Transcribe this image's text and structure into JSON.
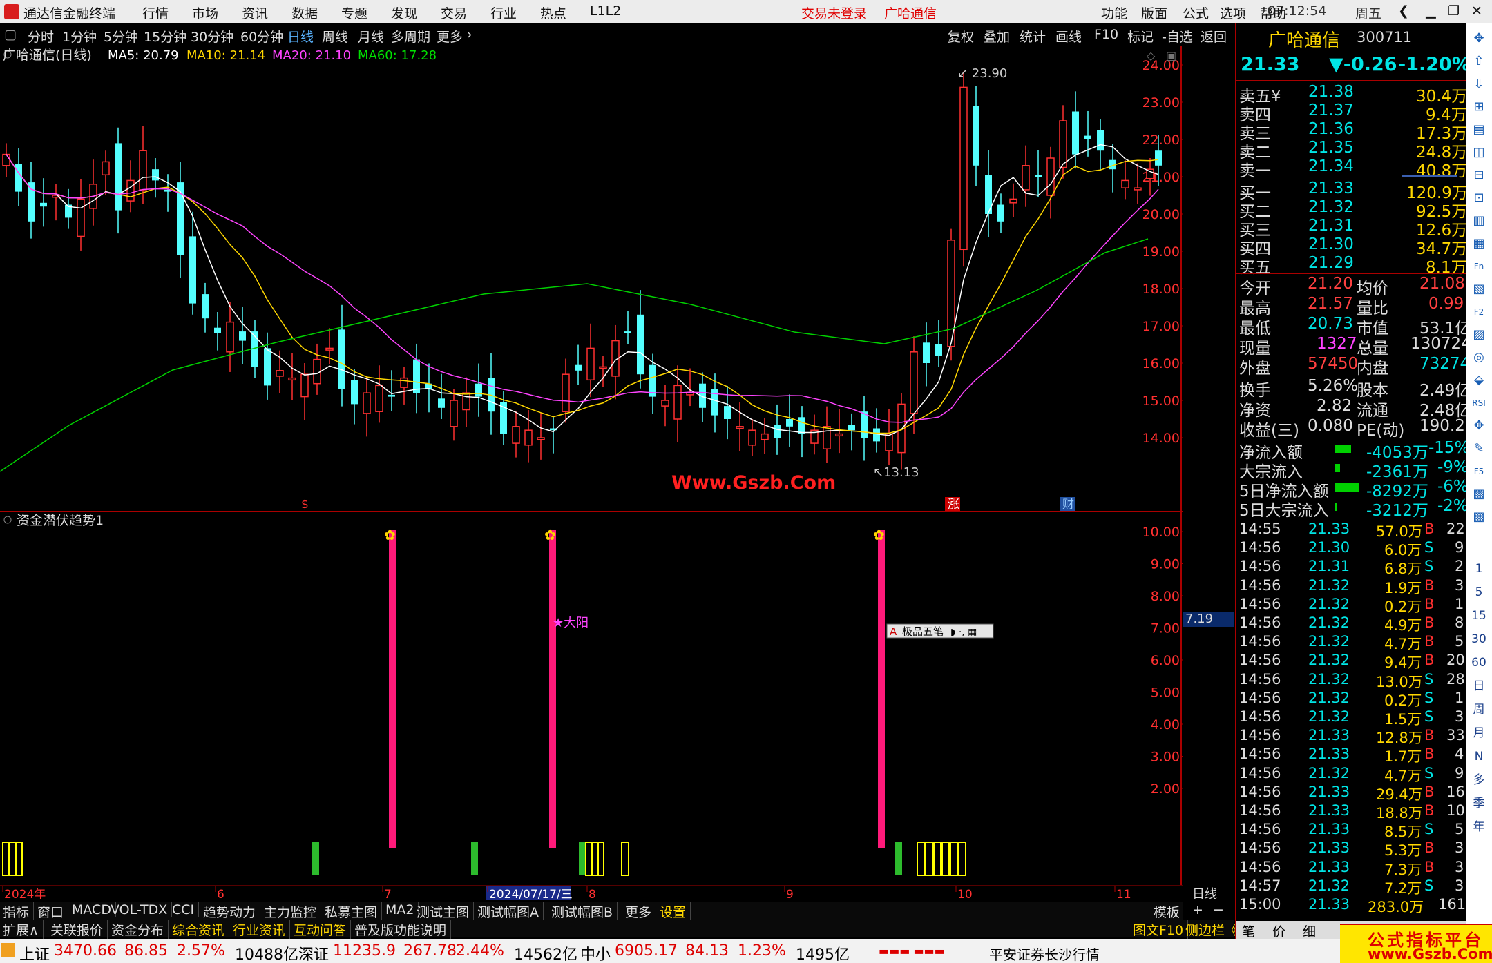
{
  "app": {
    "title": "通达信金融终端",
    "menu": [
      "行情",
      "市场",
      "资讯",
      "数据",
      "专题",
      "发现",
      "交易",
      "行业",
      "热点",
      "L1L2"
    ],
    "login_status": "交易未登录",
    "stock_name_title": "广哈通信",
    "right_menu": [
      "功能",
      "版面",
      "公式",
      "选项",
      "帮助"
    ],
    "clock": "07:12:54",
    "weekday": "周五"
  },
  "toolbar": {
    "periods": [
      "分时",
      "1分钟",
      "5分钟",
      "15分钟",
      "30分钟",
      "60分钟",
      "日线",
      "周线",
      "月线",
      "多周期",
      "更多"
    ],
    "selected": "日线",
    "right": [
      "复权",
      "叠加",
      "统计",
      "画线",
      "F10",
      "标记",
      "-自选",
      "返回"
    ]
  },
  "main_chart": {
    "header_name": "广哈通信(日线)",
    "ma": [
      {
        "label": "MA5: 20.79",
        "color": "#ffffff"
      },
      {
        "label": "MA10: 21.14",
        "color": "#ffd700"
      },
      {
        "label": "MA20: 21.10",
        "color": "#ff44ff"
      },
      {
        "label": "MA60: 17.28",
        "color": "#00e000"
      }
    ],
    "y_ticks": [
      "24.00",
      "23.00",
      "22.00",
      "21.00",
      "20.00",
      "19.00",
      "18.00",
      "17.00",
      "16.00",
      "15.00",
      "14.00"
    ],
    "high_label": "23.90",
    "low_label": "13.13",
    "watermark": "Www.Gszb.Com",
    "event_markers": [
      "$",
      "涨",
      "财"
    ]
  },
  "indicator": {
    "name": "资金潜伏趋势1",
    "y_ticks": [
      "10.00",
      "9.00",
      "8.00",
      "7.00",
      "6.00",
      "5.00",
      "4.00",
      "3.00",
      "2.00"
    ],
    "current_value": "7.19",
    "annotation": "★大阳",
    "ime_text": "极品五笔"
  },
  "x_axis": {
    "labels": [
      "2024年",
      "6",
      "7",
      "2024/07/17/三",
      "8",
      "9",
      "10",
      "11"
    ],
    "period_tag": "日线"
  },
  "bottom_tabs": {
    "row1": [
      "指标",
      "窗口",
      "MACD",
      "VOL-TDX",
      "CCI",
      "趋势动力",
      "主力监控",
      "私募主图",
      "MA2",
      "测试主图",
      "测试幅图A",
      "测试幅图B",
      "更多",
      "设置"
    ],
    "row1_right": [
      "模板",
      "+",
      "−"
    ],
    "row2": [
      {
        "label": "扩展∧",
        "color": "#ddd"
      },
      {
        "label": "关联报价",
        "color": "#ddd"
      },
      {
        "label": "资金分布",
        "color": "#ddd"
      },
      {
        "label": "综合资讯",
        "color": "#ffd700"
      },
      {
        "label": "行业资讯",
        "color": "#ffd700"
      },
      {
        "label": "互动问答",
        "color": "#ffd700"
      },
      {
        "label": "普及版功能说明",
        "color": "#ddd"
      }
    ],
    "row2_right": [
      "图文F10",
      "侧边栏《"
    ],
    "panel_tabs": [
      "笔",
      "价",
      "细"
    ]
  },
  "quote": {
    "name": "广哈通信",
    "code": "300711",
    "price": "21.33",
    "change": "▼-0.26",
    "change_pct": "-1.20%",
    "asks": [
      {
        "label": "卖五¥",
        "price": "21.38",
        "vol": "30.4万"
      },
      {
        "label": "卖四",
        "price": "21.37",
        "vol": "9.4万"
      },
      {
        "label": "卖三",
        "price": "21.36",
        "vol": "17.3万"
      },
      {
        "label": "卖二",
        "price": "21.35",
        "vol": "24.8万"
      },
      {
        "label": "卖一",
        "price": "21.34",
        "vol": "40.8万"
      }
    ],
    "bids": [
      {
        "label": "买一",
        "price": "21.33",
        "vol": "120.9万"
      },
      {
        "label": "买二",
        "price": "21.32",
        "vol": "92.5万"
      },
      {
        "label": "买三",
        "price": "21.31",
        "vol": "12.6万"
      },
      {
        "label": "买四",
        "price": "21.30",
        "vol": "34.7万"
      },
      {
        "label": "买五",
        "price": "21.29",
        "vol": "8.1万"
      }
    ],
    "stats": [
      {
        "k1": "今开",
        "v1": "21.20",
        "k2": "均价",
        "v2": "21.08",
        "c1": "#ff4040",
        "c2": "#ff4040"
      },
      {
        "k1": "最高",
        "v1": "21.57",
        "k2": "量比",
        "v2": "0.99",
        "c1": "#ff4040",
        "c2": "#ff4040"
      },
      {
        "k1": "最低",
        "v1": "20.73",
        "k2": "市值",
        "v2": "53.1亿",
        "c1": "#00e5e5",
        "c2": "#dddddd"
      },
      {
        "k1": "现量",
        "v1": "1327",
        "k2": "总量",
        "v2": "130724",
        "c1": "#ff44ff",
        "c2": "#dddddd"
      },
      {
        "k1": "外盘",
        "v1": "57450",
        "k2": "内盘",
        "v2": "73274",
        "c1": "#ff4040",
        "c2": "#00e5e5"
      }
    ],
    "fin": [
      {
        "k1": "换手",
        "v1": "5.26%",
        "k2": "股本",
        "v2": "2.49亿"
      },
      {
        "k1": "净资",
        "v1": "2.82",
        "k2": "流通",
        "v2": "2.48亿"
      },
      {
        "k1": "收益(三)",
        "v1": "0.080",
        "k2": "PE(动)",
        "v2": "190.2"
      }
    ],
    "flows": [
      {
        "label": "净流入额",
        "bar": 24,
        "value": "-4053万",
        "pct": "-15%"
      },
      {
        "label": "大宗流入",
        "bar": 8,
        "value": "-2361万",
        "pct": "-9%"
      },
      {
        "label": "5日净流入额",
        "bar": 36,
        "value": "-8292万",
        "pct": "-6%"
      },
      {
        "label": "5日大宗流入",
        "bar": 4,
        "value": "-3212万",
        "pct": "-2%"
      }
    ],
    "ticks": [
      {
        "t": "14:55",
        "p": "21.33",
        "v": "57.0万",
        "d": "B",
        "n": "22"
      },
      {
        "t": "14:56",
        "p": "21.30",
        "v": "6.0万",
        "d": "S",
        "n": "9"
      },
      {
        "t": "14:56",
        "p": "21.31",
        "v": "6.8万",
        "d": "S",
        "n": "2"
      },
      {
        "t": "14:56",
        "p": "21.32",
        "v": "1.9万",
        "d": "B",
        "n": "3"
      },
      {
        "t": "14:56",
        "p": "21.32",
        "v": "0.2万",
        "d": "B",
        "n": "1"
      },
      {
        "t": "14:56",
        "p": "21.32",
        "v": "4.9万",
        "d": "B",
        "n": "8"
      },
      {
        "t": "14:56",
        "p": "21.32",
        "v": "4.7万",
        "d": "B",
        "n": "5"
      },
      {
        "t": "14:56",
        "p": "21.32",
        "v": "9.4万",
        "d": "B",
        "n": "20"
      },
      {
        "t": "14:56",
        "p": "21.32",
        "v": "13.0万",
        "d": "S",
        "n": "28"
      },
      {
        "t": "14:56",
        "p": "21.32",
        "v": "0.2万",
        "d": "S",
        "n": "1"
      },
      {
        "t": "14:56",
        "p": "21.32",
        "v": "1.5万",
        "d": "S",
        "n": "3"
      },
      {
        "t": "14:56",
        "p": "21.33",
        "v": "12.8万",
        "d": "B",
        "n": "33"
      },
      {
        "t": "14:56",
        "p": "21.33",
        "v": "1.7万",
        "d": "B",
        "n": "4"
      },
      {
        "t": "14:56",
        "p": "21.32",
        "v": "4.7万",
        "d": "S",
        "n": "9"
      },
      {
        "t": "14:56",
        "p": "21.33",
        "v": "29.4万",
        "d": "B",
        "n": "16"
      },
      {
        "t": "14:56",
        "p": "21.33",
        "v": "18.8万",
        "d": "B",
        "n": "10"
      },
      {
        "t": "14:56",
        "p": "21.33",
        "v": "8.5万",
        "d": "S",
        "n": "5"
      },
      {
        "t": "14:56",
        "p": "21.33",
        "v": "5.3万",
        "d": "B",
        "n": "3"
      },
      {
        "t": "14:56",
        "p": "21.33",
        "v": "7.3万",
        "d": "B",
        "n": "3"
      },
      {
        "t": "14:57",
        "p": "21.32",
        "v": "7.2万",
        "d": "S",
        "n": "3"
      },
      {
        "t": "15:00",
        "p": "21.33",
        "v": "283.0万",
        "d": "",
        "n": "161"
      }
    ]
  },
  "side_icons": [
    "1",
    "5",
    "15",
    "30",
    "60",
    "日",
    "周",
    "月",
    "N",
    "多",
    "季",
    "年"
  ],
  "statusbar": {
    "items": [
      {
        "label": "上证",
        "v1": "3470.66",
        "v2": "86.85",
        "v3": "2.57%",
        "amt": "10488亿"
      },
      {
        "label": "深证",
        "v1": "11235.9",
        "v2": "267.78",
        "v3": "2.44%",
        "amt": "14562亿"
      },
      {
        "label": "中小",
        "v1": "6905.17",
        "v2": "84.13",
        "v3": "1.23%",
        "amt": "1495亿"
      }
    ],
    "broker": "平安证券长沙行情",
    "brand": "公式指标平台",
    "brand_url": "www.Gszb.Com"
  }
}
